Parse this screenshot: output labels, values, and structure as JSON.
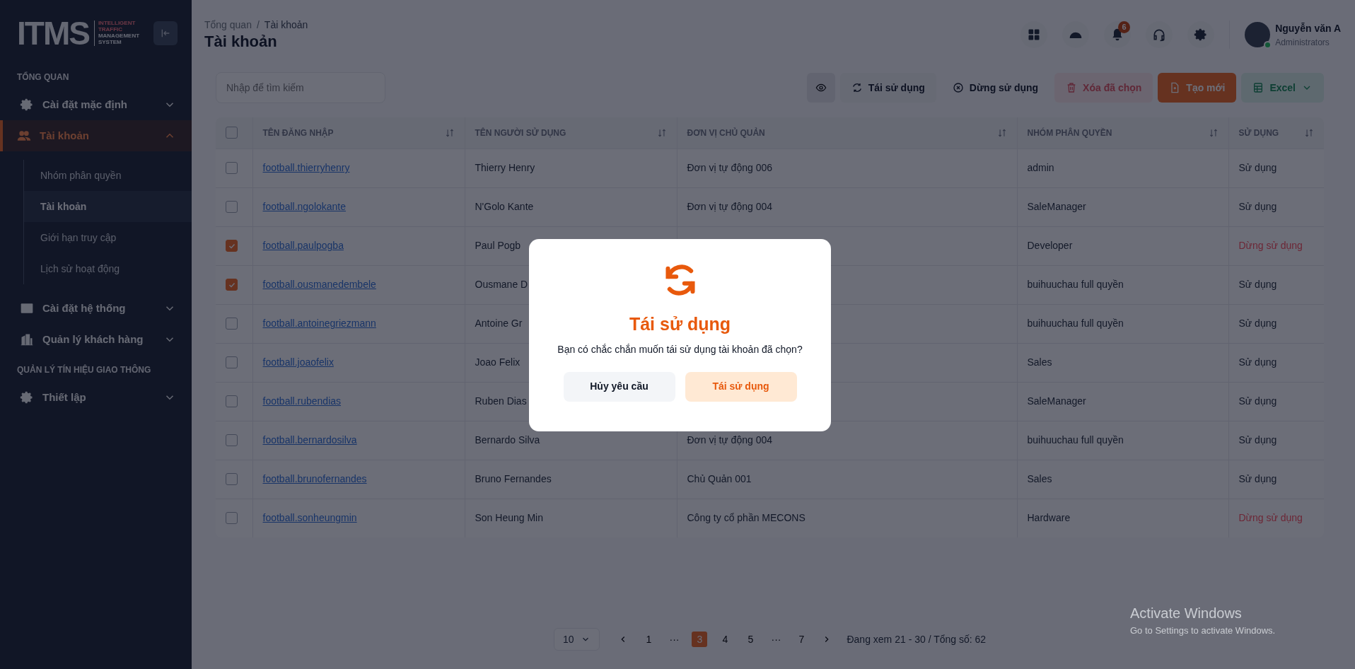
{
  "sidebar": {
    "logo": {
      "mark": "ITMS",
      "tagline": [
        "INTELLIGENT",
        "TRAFFIC",
        "MANAGEMENT",
        "SYSTEM"
      ]
    },
    "sections": [
      {
        "heading": "TỔNG QUAN",
        "items": [
          {
            "label": "Cài đặt mặc định",
            "selected": false,
            "expanded": false
          },
          {
            "label": "Tài khoản",
            "selected": true,
            "expanded": true,
            "children": [
              {
                "label": "Nhóm phân quyền",
                "selected": false
              },
              {
                "label": "Tài khoản",
                "selected": true
              },
              {
                "label": "Giới hạn truy cập",
                "selected": false
              },
              {
                "label": "Lịch sử hoạt động",
                "selected": false
              }
            ]
          },
          {
            "label": "Cài đặt hệ thống",
            "selected": false,
            "expanded": false
          },
          {
            "label": "Quản lý khách hàng",
            "selected": false,
            "expanded": false
          }
        ]
      },
      {
        "heading": "QUẢN LÝ TÍN HIỆU GIAO THÔNG",
        "items": [
          {
            "label": "Thiết lập",
            "selected": false,
            "expanded": false
          }
        ]
      }
    ]
  },
  "header": {
    "breadcrumb": [
      "Tổng quan",
      "Tài khoản"
    ],
    "breadcrumb_separator": "/",
    "title": "Tài khoản",
    "notification_count": "6",
    "user": {
      "name": "Nguyễn văn A",
      "role": "Administrators",
      "online": true
    }
  },
  "toolbar": {
    "search": {
      "placeholder": "Nhập để tìm kiếm"
    },
    "buttons": [
      {
        "kind": "view"
      },
      {
        "kind": "reuse",
        "label": "Tái sử dụng"
      },
      {
        "kind": "stop",
        "label": "Dừng sử dụng"
      },
      {
        "kind": "delete",
        "label": "Xóa đã chọn"
      },
      {
        "kind": "create",
        "label": "Tạo mới"
      },
      {
        "kind": "excel",
        "label": "Excel"
      }
    ]
  },
  "table": {
    "all_selected": false,
    "columns": [
      "TÊN ĐĂNG NHẬP",
      "TÊN NGƯỜI SỬ DỤNG",
      "ĐƠN VỊ CHỦ QUẢN",
      "NHÓM PHÂN QUYỀN",
      "SỬ DỤNG"
    ],
    "rows": [
      {
        "selected": false,
        "username": "football.thierryhenry",
        "name": "Thierry Henry",
        "unit": "Đơn vị tự động 006",
        "group": "admin",
        "status": "Sử dụng",
        "active": true
      },
      {
        "selected": false,
        "username": "football.ngolokante",
        "name": "N'Golo Kante",
        "unit": "Đơn vị tự động 004",
        "group": "SaleManager",
        "status": "Sử dụng",
        "active": true
      },
      {
        "selected": true,
        "username": "football.paulpogba",
        "name": "Paul Pogb",
        "group": "Developer",
        "status": "Dừng sử dụng",
        "active": false
      },
      {
        "selected": true,
        "username": "football.ousmanedembele",
        "name": "Ousmane D",
        "group": "buihuuchau full quyền",
        "status": "Sử dụng",
        "active": true
      },
      {
        "selected": false,
        "username": "football.antoinegriezmann",
        "name": "Antoine Gr",
        "group": "buihuuchau full quyền",
        "status": "Sử dụng",
        "active": true
      },
      {
        "selected": false,
        "username": "football.joaofelix",
        "name": "Joao Felix",
        "group": "Sales",
        "status": "Sử dụng",
        "active": true
      },
      {
        "selected": false,
        "username": "football.rubendias",
        "name": "Ruben Dias",
        "group": "SaleManager",
        "status": "Sử dụng",
        "active": true
      },
      {
        "selected": false,
        "username": "football.bernardosilva",
        "name": "Bernardo Silva",
        "unit": "Đơn vị tự động 004",
        "group": "buihuuchau full quyền",
        "status": "Sử dụng",
        "active": true
      },
      {
        "selected": false,
        "username": "football.brunofernandes",
        "name": "Bruno Fernandes",
        "unit": "Chủ Quản 001",
        "group": "Sales",
        "status": "Sử dụng",
        "active": true
      },
      {
        "selected": false,
        "username": "football.sonheungmin",
        "name": "Son Heung Min",
        "unit": "Công ty cổ phần MECONS",
        "group": "Hardware",
        "status": "Dừng sử dụng",
        "active": false
      }
    ]
  },
  "pagination": {
    "page_size": "10",
    "pages": [
      {
        "label": "1",
        "selected": false
      },
      {
        "label": "···",
        "selected": false
      },
      {
        "label": "3",
        "selected": true
      },
      {
        "label": "4",
        "selected": false
      },
      {
        "label": "5",
        "selected": false
      },
      {
        "label": "···",
        "selected": false
      },
      {
        "label": "7",
        "selected": false
      }
    ],
    "summary": "Đang xem 21 - 30 / Tổng số: 62"
  },
  "modal": {
    "title": "Tái sử dụng",
    "message": "Bạn có chắc chắn muốn tái sử dụng tài khoản đã chọn?",
    "buttons": [
      {
        "kind": "cancel",
        "label": "Hủy yêu cầu"
      },
      {
        "kind": "confirm",
        "label": "Tái sử dụng"
      }
    ]
  },
  "os_notice": {
    "title": "Activate Windows",
    "text": "Go to Settings to activate Windows."
  }
}
